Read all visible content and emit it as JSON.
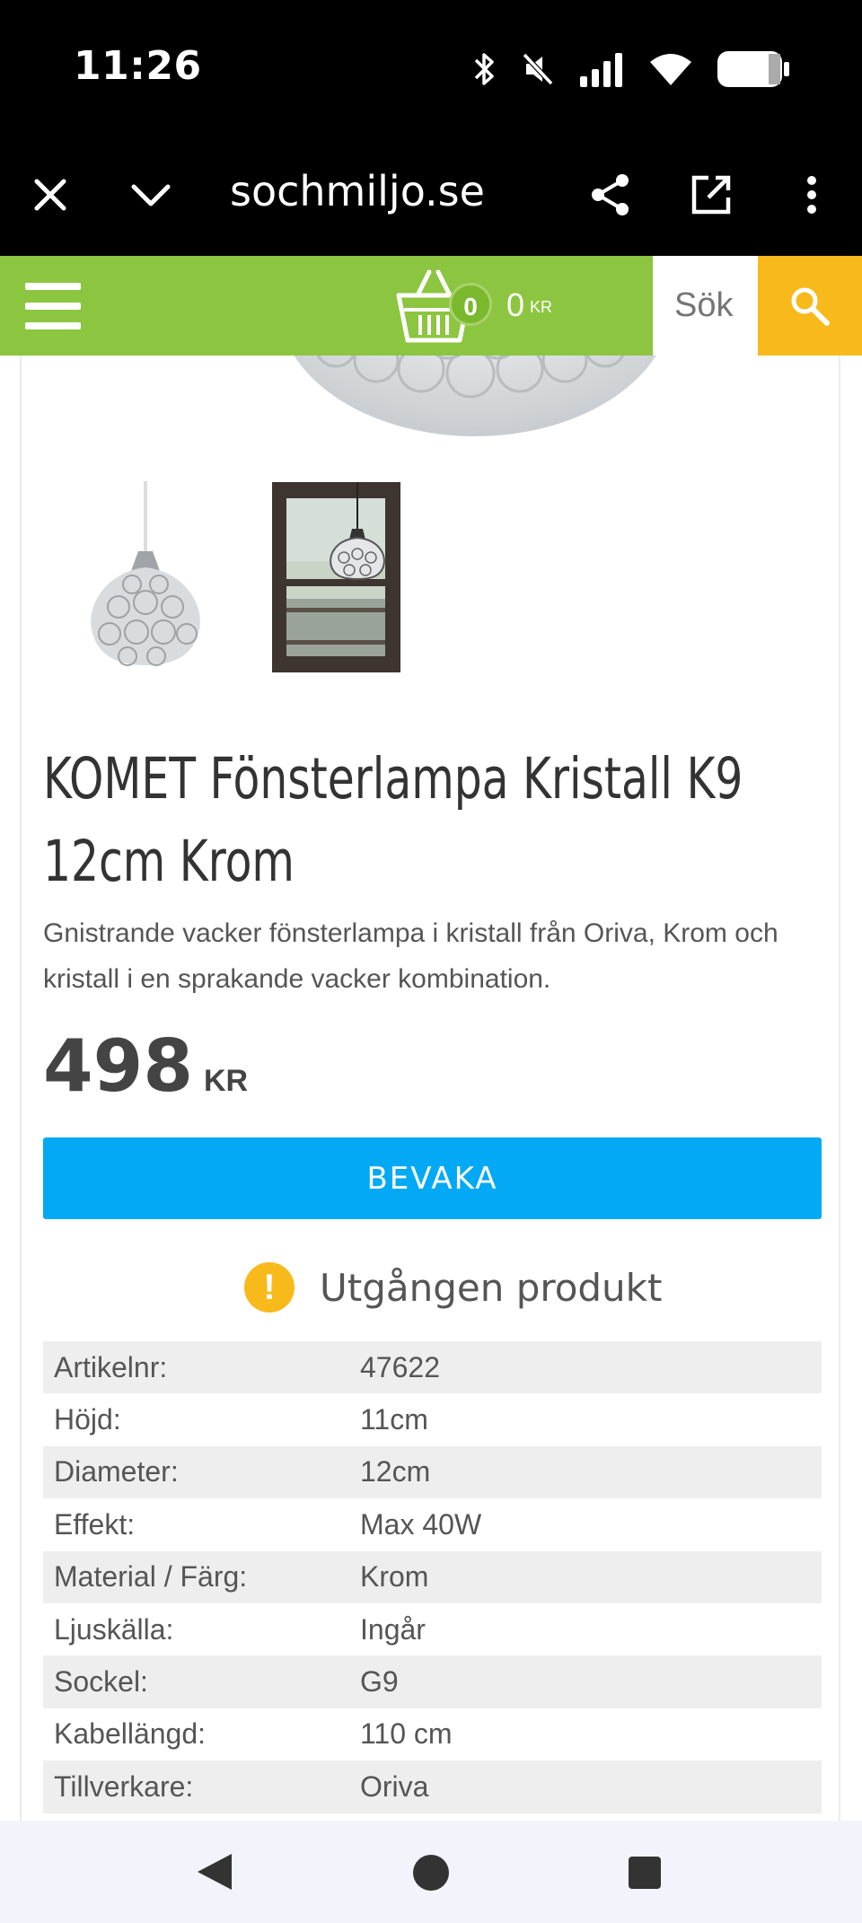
{
  "status_bar": {
    "time": "11:26",
    "icons": [
      "bluetooth-icon",
      "mute-icon",
      "signal-icon",
      "wifi-icon",
      "battery-icon"
    ]
  },
  "browser": {
    "url": "sochmiljo.se",
    "icons": [
      "close-icon",
      "chevron-down-icon",
      "share-icon",
      "open-external-icon",
      "more-vert-icon"
    ]
  },
  "site_header": {
    "cart_count": "0",
    "cart_total": "0",
    "cart_currency": "KR",
    "search_placeholder": "Sök",
    "colors": {
      "header_green": "#8cc53f",
      "search_yellow": "#f8b91b"
    }
  },
  "product": {
    "title": "KOMET Fönsterlampa Kristall K9 12cm Krom",
    "description": "Gnistrande vacker fönsterlampa i kristall från Oriva, Krom och kristall i en sprakande vacker kombination.",
    "price": "498",
    "currency": "KR",
    "watch_label": "BEVAKA",
    "availability": "Utgången produkt",
    "colors": {
      "watch_blue": "#03a9f4",
      "warning_yellow": "#f8b91b"
    }
  },
  "specs": [
    {
      "key": "Artikelnr:",
      "value": "47622"
    },
    {
      "key": "Höjd:",
      "value": "11cm"
    },
    {
      "key": "Diameter:",
      "value": "12cm"
    },
    {
      "key": "Effekt:",
      "value": "Max 40W"
    },
    {
      "key": "Material / Färg:",
      "value": "Krom"
    },
    {
      "key": "Ljuskälla:",
      "value": "Ingår"
    },
    {
      "key": "Sockel:",
      "value": "G9"
    },
    {
      "key": "Kabellängd:",
      "value": "110 cm"
    },
    {
      "key": "Tillverkare:",
      "value": "Oriva"
    }
  ]
}
